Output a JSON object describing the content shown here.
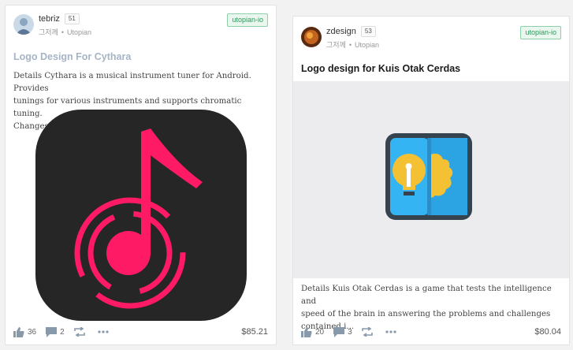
{
  "posts": [
    {
      "author": "tebriz",
      "reputation": "51",
      "time": "그저께",
      "category": "Utopian",
      "tag": "utopian-io",
      "title": "Logo Design For Cythara",
      "excerpt_lines": [
        "Details Cythara is a musical instrument tuner for Android. Provides",
        "tunings for various instruments and supports chromatic tuning.",
        "Changes..."
      ],
      "votes": "36",
      "comments": "2",
      "payout": "$85.21",
      "image_icon": "music-note-logo-icon",
      "colors": {
        "background": "#262626",
        "accent": "#ff1a66"
      }
    },
    {
      "author": "zdesign",
      "reputation": "53",
      "time": "그저께",
      "category": "Utopian",
      "tag": "utopian-io",
      "title": "Logo design for Kuis Otak Cerdas",
      "excerpt_lines": [
        "Details Kuis Otak Cerdas is a game that tests the intelligence and",
        "speed of the brain in answering the problems and challenges",
        "contained i..."
      ],
      "votes": "20",
      "comments": "3",
      "payout": "$80.04",
      "image_icon": "lightbulb-brain-logo-icon",
      "colors": {
        "blue": "#34b4f2",
        "yellow": "#f4c134",
        "border": "#34434d"
      }
    }
  ]
}
